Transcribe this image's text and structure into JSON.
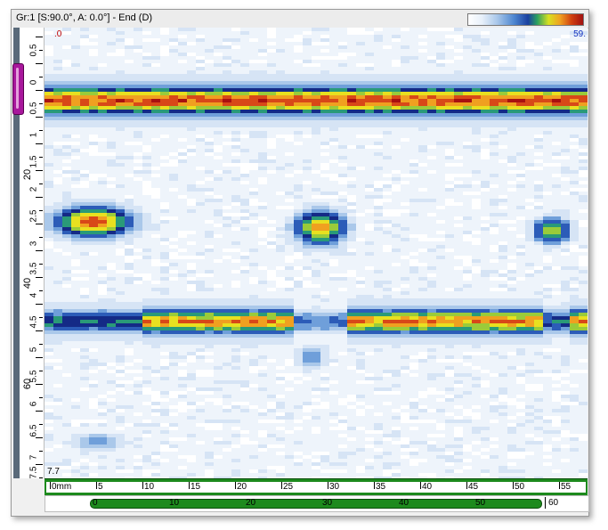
{
  "window": {
    "title": "Gr:1 [S:90.0°, A: 0.0°] - End (D)",
    "palette_colors": [
      "#ffffff",
      "#e8f0fa",
      "#aac8ea",
      "#4d86d0",
      "#1a40a0",
      "#2aa060",
      "#d8e020",
      "#f0a020",
      "#d04010",
      "#a01010"
    ]
  },
  "plot": {
    "top_left_value": ".0",
    "top_right_value": "59.",
    "bottom_left_value": "7.7"
  },
  "left_ruler": {
    "minor_labels": [
      "0.5",
      "0",
      "0.5",
      "1",
      "1.5",
      "2",
      "2.5",
      "3",
      "3.5",
      "4",
      "4.5",
      "5",
      "5.5",
      "6",
      "6.5",
      "7",
      "7.5"
    ],
    "major_labels": [
      "20",
      "40",
      "60"
    ],
    "cursor_color": "#a8179c"
  },
  "bottom_ruler": {
    "labels": [
      "0mm",
      "5",
      "10",
      "15",
      "20",
      "25",
      "30",
      "35",
      "40",
      "45",
      "50",
      "55"
    ]
  },
  "scrollbar": {
    "labels": [
      "0",
      "10",
      "20",
      "30",
      "40",
      "50"
    ],
    "end_label": "60"
  },
  "colors": {
    "ruler_green": "#1d8a1d",
    "cursor_purple": "#a8179c"
  }
}
